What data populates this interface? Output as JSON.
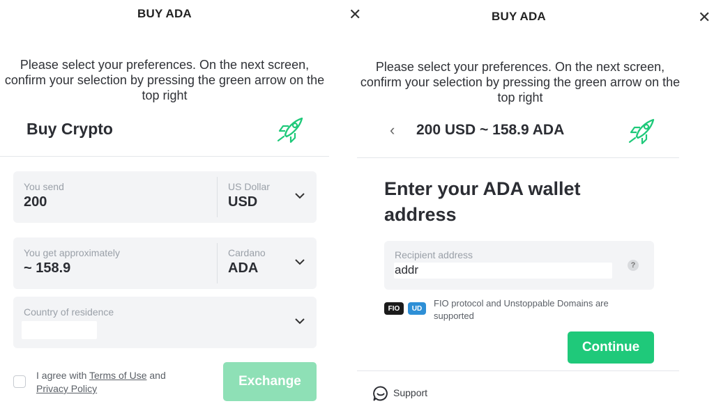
{
  "left": {
    "title": "BUY ADA",
    "close_icon": "close-icon",
    "instructions": "Please select your preferences. On the next screen, confirm your selection by pressing the green arrow on the top right",
    "heading": "Buy Crypto",
    "send": {
      "label": "You send",
      "value": "200",
      "currency_label": "US Dollar",
      "currency_code": "USD"
    },
    "get": {
      "label": "You get approximately",
      "value": "~ 158.9",
      "currency_label": "Cardano",
      "currency_code": "ADA"
    },
    "country": {
      "label": "Country of residence",
      "value": ""
    },
    "agree": {
      "prefix": "I agree with ",
      "terms": "Terms of Use",
      "middle": " and",
      "privacy": "Privacy Policy"
    },
    "exchange_button": "Exchange"
  },
  "right": {
    "title": "BUY ADA",
    "close_icon": "close-icon",
    "instructions": "Please select your preferences. On the next screen, confirm your selection by pressing the green arrow on the top right",
    "summary": "200 USD ~ 158.9 ADA",
    "back_icon": "chevron-left-icon",
    "heading_line1": "Enter your ADA wallet",
    "heading_line2": "address",
    "recipient": {
      "label": "Recipient address",
      "value": "addr"
    },
    "help_icon": "?",
    "badges": {
      "fio": "FIO",
      "ud": "UD"
    },
    "protocol_text_line1": "FIO protocol and Unstoppable Domains are",
    "protocol_text_line2": "supported",
    "continue_button": "Continue",
    "support": "Support"
  },
  "colors": {
    "accent": "#1fc97a",
    "accent_disabled": "#8ee0b6",
    "field_bg": "#f3f4f6",
    "fio_badge": "#1b1b1b",
    "ud_badge": "#2e8fd6"
  }
}
